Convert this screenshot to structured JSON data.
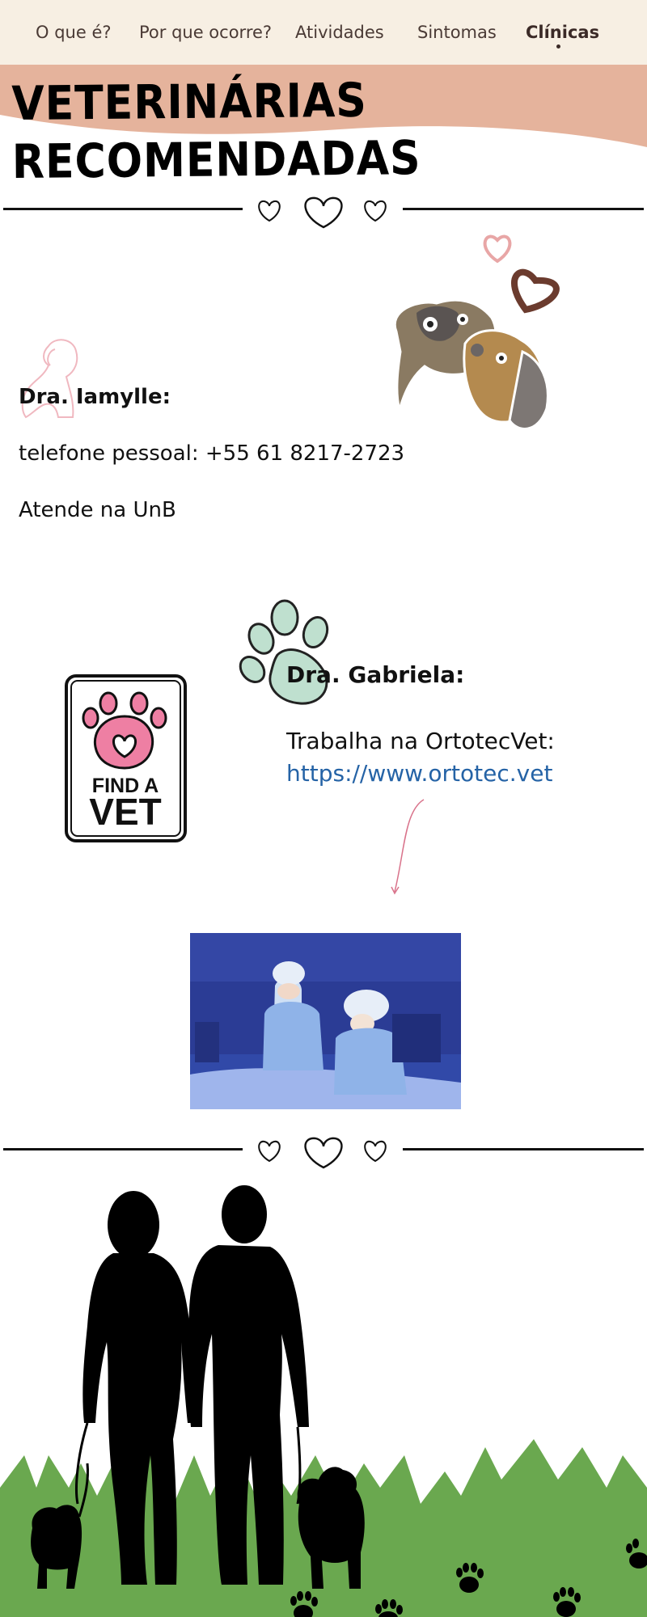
{
  "nav": {
    "items": [
      {
        "label": "O que é?"
      },
      {
        "label": "Por que ocorre?"
      },
      {
        "label": "Atividades"
      },
      {
        "label": "Sintomas"
      },
      {
        "label": "Clínicas"
      }
    ]
  },
  "page_title": "VETERINÁRIAS RECOMENDADAS",
  "vets": [
    {
      "name": "Dra. Iamylle:",
      "phone": "telefone pessoal: +55 61 8217-2723",
      "location": "Atende na UnB"
    },
    {
      "name": "Dra. Gabriela:",
      "workplace": "Trabalha na OrtotecVet:",
      "link": "https://www.ortotec.vet"
    }
  ],
  "find_vet_badge": {
    "line1": "FIND A",
    "line2": "VET"
  },
  "icons": [
    "heart-icon",
    "paw-print-icon",
    "dogs-illustration",
    "dog-outline-icon",
    "find-a-vet-logo",
    "surgery-photo",
    "couple-walking-dogs-silhouette"
  ],
  "colors": {
    "nav_bg": "#f7efe3",
    "banner": "#e5b39c",
    "link": "#2563a6",
    "paw_green": "#bfe0cf",
    "grass": "#6aa84f",
    "heart_brown": "#6b3b2e",
    "heart_pink": "#e8a6a6"
  }
}
